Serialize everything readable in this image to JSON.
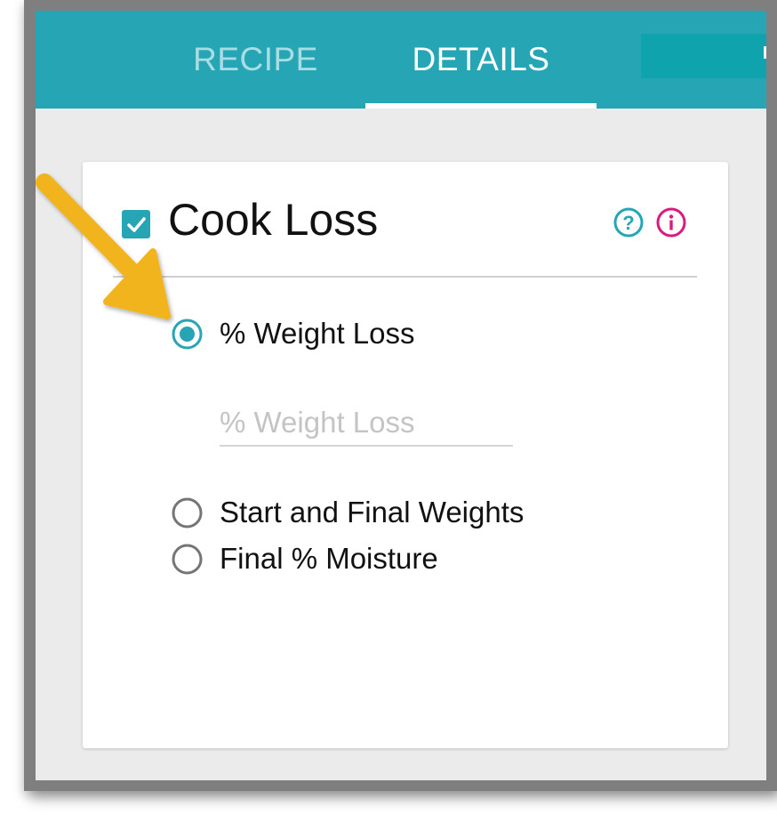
{
  "tabs": {
    "recipe": "RECIPE",
    "details": "DETAILS",
    "active": "DETAILS"
  },
  "card": {
    "title": "Cook Loss",
    "enabled": true
  },
  "icons": {
    "help": "question-circle-icon",
    "info": "info-circle-icon",
    "checkbox": "check-icon",
    "annotation": "arrow-annotation"
  },
  "options": [
    {
      "label": "% Weight Loss",
      "selected": true
    },
    {
      "label": "Start and Final Weights",
      "selected": false
    },
    {
      "label": "Final % Moisture",
      "selected": false
    }
  ],
  "weight_loss_field": {
    "placeholder": "% Weight Loss",
    "value": ""
  },
  "colors": {
    "primary": "#26a6b5",
    "accent": "#d81b7f",
    "arrow": "#f2b41c",
    "background": "#ebebeb"
  }
}
